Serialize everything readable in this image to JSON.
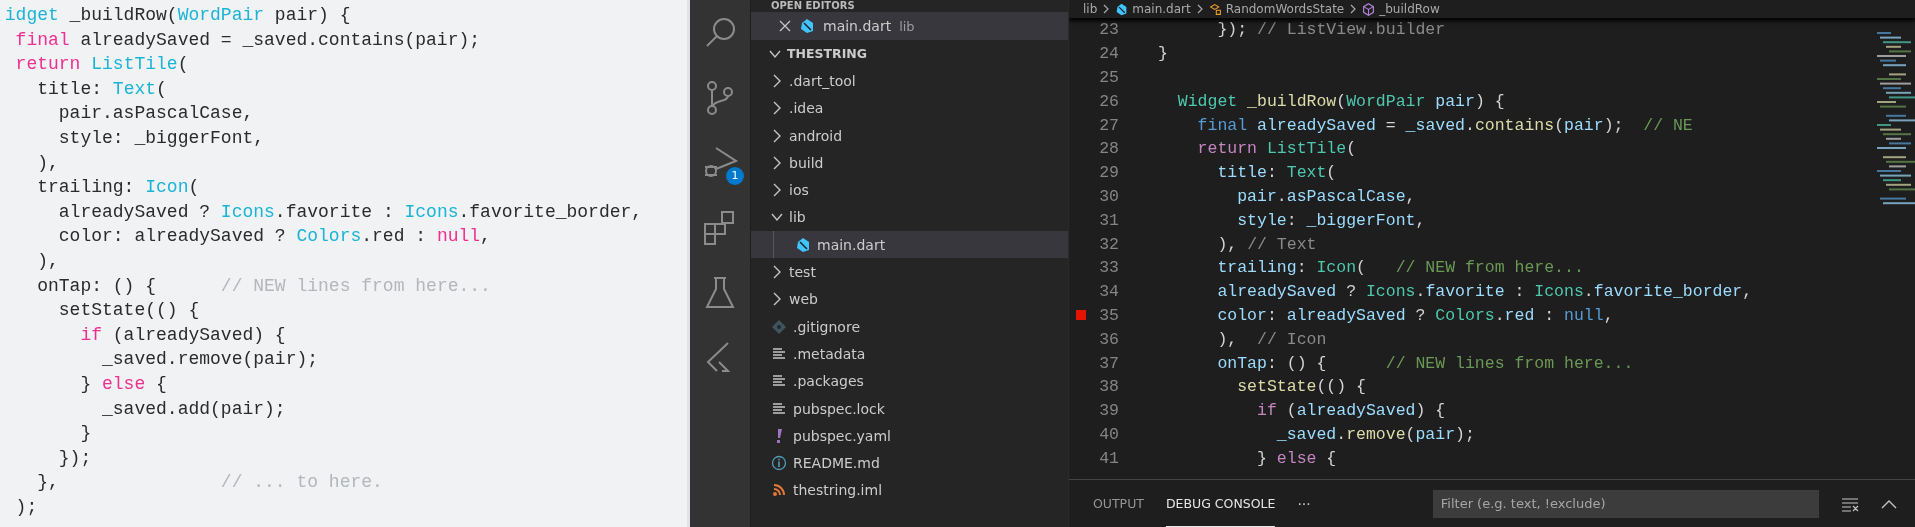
{
  "snippet": {
    "lines": [
      [
        {
          "text": "idget",
          "kind": "type"
        },
        {
          "text": " _buildRow(",
          "kind": "plain"
        },
        {
          "text": "WordPair",
          "kind": "type"
        },
        {
          "text": " pair) {",
          "kind": "plain"
        }
      ],
      [
        {
          "text": " final",
          "kind": "kw"
        },
        {
          "text": " alreadySaved = _saved.contains(pair);",
          "kind": "plain"
        }
      ],
      [
        {
          "text": " return",
          "kind": "kw"
        },
        {
          "text": " ListTile",
          "kind": "type"
        },
        {
          "text": "(",
          "kind": "plain"
        }
      ],
      [
        {
          "text": "   title: ",
          "kind": "plain"
        },
        {
          "text": "Text",
          "kind": "type"
        },
        {
          "text": "(",
          "kind": "plain"
        }
      ],
      [
        {
          "text": "     pair.asPascalCase,",
          "kind": "plain"
        }
      ],
      [
        {
          "text": "     style: _biggerFont,",
          "kind": "plain"
        }
      ],
      [
        {
          "text": "   ),",
          "kind": "plain"
        }
      ],
      [
        {
          "text": "   trailing: ",
          "kind": "plain"
        },
        {
          "text": "Icon",
          "kind": "type"
        },
        {
          "text": "(",
          "kind": "plain"
        }
      ],
      [
        {
          "text": "     alreadySaved ? ",
          "kind": "plain"
        },
        {
          "text": "Icons",
          "kind": "type"
        },
        {
          "text": ".favorite : ",
          "kind": "plain"
        },
        {
          "text": "Icons",
          "kind": "type"
        },
        {
          "text": ".favorite_border,",
          "kind": "plain"
        }
      ],
      [
        {
          "text": "     color: alreadySaved ? ",
          "kind": "plain"
        },
        {
          "text": "Colors",
          "kind": "type"
        },
        {
          "text": ".red : ",
          "kind": "plain"
        },
        {
          "text": "null",
          "kind": "kw"
        },
        {
          "text": ",",
          "kind": "plain"
        }
      ],
      [
        {
          "text": "   ),",
          "kind": "plain"
        }
      ],
      [
        {
          "text": "   onTap: () {      ",
          "kind": "plain"
        },
        {
          "text": "// NEW lines from here...",
          "kind": "comment"
        }
      ],
      [
        {
          "text": "     setState(() {",
          "kind": "plain"
        }
      ],
      [
        {
          "text": "       if",
          "kind": "kw"
        },
        {
          "text": " (alreadySaved) {",
          "kind": "plain"
        }
      ],
      [
        {
          "text": "         _saved.remove(pair);",
          "kind": "plain"
        }
      ],
      [
        {
          "text": "       } ",
          "kind": "plain"
        },
        {
          "text": "else",
          "kind": "kw"
        },
        {
          "text": " {",
          "kind": "plain"
        }
      ],
      [
        {
          "text": "         _saved.add(pair);",
          "kind": "plain"
        }
      ],
      [
        {
          "text": "       }",
          "kind": "plain"
        }
      ],
      [
        {
          "text": "     });",
          "kind": "plain"
        }
      ],
      [
        {
          "text": "   },               ",
          "kind": "plain"
        },
        {
          "text": "// ... to here.",
          "kind": "comment"
        }
      ],
      [
        {
          "text": " );",
          "kind": "plain"
        }
      ]
    ]
  },
  "activity_bar": {
    "debug_badge": "1"
  },
  "explorer": {
    "open_editors_header": "OPEN EDITORS",
    "open_editors": [
      {
        "name": "main.dart",
        "description": "lib",
        "kind": "dart"
      }
    ],
    "folder": {
      "name": "THESTRING",
      "expanded": true
    },
    "tree": [
      {
        "name": ".dart_tool",
        "kind": "folder",
        "expanded": false,
        "selected": false
      },
      {
        "name": ".idea",
        "kind": "folder",
        "expanded": false,
        "selected": false
      },
      {
        "name": "android",
        "kind": "folder",
        "expanded": false,
        "selected": false
      },
      {
        "name": "build",
        "kind": "folder",
        "expanded": false,
        "selected": false
      },
      {
        "name": "ios",
        "kind": "folder",
        "expanded": false,
        "selected": false
      },
      {
        "name": "lib",
        "kind": "folder",
        "expanded": true,
        "selected": false,
        "children": [
          {
            "name": "main.dart",
            "kind": "dart",
            "selected": true
          }
        ]
      },
      {
        "name": "test",
        "kind": "folder",
        "expanded": false,
        "selected": false
      },
      {
        "name": "web",
        "kind": "folder",
        "expanded": false,
        "selected": false
      },
      {
        "name": ".gitignore",
        "kind": "git",
        "selected": false
      },
      {
        "name": ".metadata",
        "kind": "text",
        "selected": false
      },
      {
        "name": ".packages",
        "kind": "text",
        "selected": false
      },
      {
        "name": "pubspec.lock",
        "kind": "text",
        "selected": false
      },
      {
        "name": "pubspec.yaml",
        "kind": "yaml",
        "selected": false
      },
      {
        "name": "README.md",
        "kind": "info",
        "selected": false
      },
      {
        "name": "thestring.iml",
        "kind": "feed",
        "selected": false
      }
    ]
  },
  "editor": {
    "breadcrumbs": [
      {
        "label": "lib",
        "kind": "folder"
      },
      {
        "label": "main.dart",
        "kind": "dart"
      },
      {
        "label": "RandomWordsState",
        "kind": "class"
      },
      {
        "label": "_buildRow",
        "kind": "method"
      }
    ],
    "lines": [
      {
        "n": "23",
        "breakpoint": false,
        "tokens": [
          {
            "text": "      });",
            "kind": "plain"
          },
          {
            "text": " // ListView.builder",
            "kind": "label"
          }
        ]
      },
      {
        "n": "24",
        "breakpoint": false,
        "tokens": [
          {
            "text": "}",
            "kind": "plain"
          }
        ]
      },
      {
        "n": "25",
        "breakpoint": false
      },
      {
        "n": "26",
        "breakpoint": false,
        "tokens": [
          {
            "text": "  Widget",
            "kind": "type"
          },
          {
            "text": " _buildRow",
            "kind": "fn"
          },
          {
            "text": "(",
            "kind": "plain"
          },
          {
            "text": "WordPair",
            "kind": "type"
          },
          {
            "text": " pair",
            "kind": "var"
          },
          {
            "text": ") {",
            "kind": "plain"
          }
        ]
      },
      {
        "n": "27",
        "breakpoint": false,
        "tokens": [
          {
            "text": "    final",
            "kind": "kw"
          },
          {
            "text": " alreadySaved",
            "kind": "var"
          },
          {
            "text": " = ",
            "kind": "plain"
          },
          {
            "text": "_saved",
            "kind": "var"
          },
          {
            "text": ".",
            "kind": "plain"
          },
          {
            "text": "contains",
            "kind": "fn"
          },
          {
            "text": "(",
            "kind": "plain"
          },
          {
            "text": "pair",
            "kind": "var"
          },
          {
            "text": ");  ",
            "kind": "plain"
          },
          {
            "text": "// NE",
            "kind": "comment"
          }
        ]
      },
      {
        "n": "28",
        "breakpoint": false,
        "tokens": [
          {
            "text": "    return",
            "kind": "ctrl"
          },
          {
            "text": " ListTile",
            "kind": "type"
          },
          {
            "text": "(",
            "kind": "plain"
          }
        ]
      },
      {
        "n": "29",
        "breakpoint": false,
        "tokens": [
          {
            "text": "      title",
            "kind": "var"
          },
          {
            "text": ": ",
            "kind": "plain"
          },
          {
            "text": "Text",
            "kind": "type"
          },
          {
            "text": "(",
            "kind": "plain"
          }
        ]
      },
      {
        "n": "30",
        "breakpoint": false,
        "tokens": [
          {
            "text": "        pair",
            "kind": "var"
          },
          {
            "text": ".",
            "kind": "plain"
          },
          {
            "text": "asPascalCase",
            "kind": "var"
          },
          {
            "text": ",",
            "kind": "plain"
          }
        ]
      },
      {
        "n": "31",
        "breakpoint": false,
        "tokens": [
          {
            "text": "        style",
            "kind": "var"
          },
          {
            "text": ": ",
            "kind": "plain"
          },
          {
            "text": "_biggerFont",
            "kind": "var"
          },
          {
            "text": ",",
            "kind": "plain"
          }
        ]
      },
      {
        "n": "32",
        "breakpoint": false,
        "tokens": [
          {
            "text": "      ), ",
            "kind": "plain"
          },
          {
            "text": "// Text",
            "kind": "label"
          }
        ]
      },
      {
        "n": "33",
        "breakpoint": false,
        "tokens": [
          {
            "text": "      trailing",
            "kind": "var"
          },
          {
            "text": ": ",
            "kind": "plain"
          },
          {
            "text": "Icon",
            "kind": "type"
          },
          {
            "text": "(   ",
            "kind": "plain"
          },
          {
            "text": "// NEW from here...",
            "kind": "comment"
          }
        ]
      },
      {
        "n": "34",
        "breakpoint": false,
        "tokens": [
          {
            "text": "      alreadySaved",
            "kind": "var"
          },
          {
            "text": " ? ",
            "kind": "plain"
          },
          {
            "text": "Icons",
            "kind": "type"
          },
          {
            "text": ".",
            "kind": "plain"
          },
          {
            "text": "favorite",
            "kind": "var"
          },
          {
            "text": " : ",
            "kind": "plain"
          },
          {
            "text": "Icons",
            "kind": "type"
          },
          {
            "text": ".",
            "kind": "plain"
          },
          {
            "text": "favorite_border",
            "kind": "var"
          },
          {
            "text": ",",
            "kind": "plain"
          }
        ]
      },
      {
        "n": "35",
        "breakpoint": true,
        "tokens": [
          {
            "text": "      color",
            "kind": "var"
          },
          {
            "text": ": ",
            "kind": "plain"
          },
          {
            "text": "alreadySaved",
            "kind": "var"
          },
          {
            "text": " ? ",
            "kind": "plain"
          },
          {
            "text": "Colors",
            "kind": "type"
          },
          {
            "text": ".",
            "kind": "plain"
          },
          {
            "text": "red",
            "kind": "var"
          },
          {
            "text": " : ",
            "kind": "plain"
          },
          {
            "text": "null",
            "kind": "kw"
          },
          {
            "text": ",",
            "kind": "plain"
          }
        ]
      },
      {
        "n": "36",
        "breakpoint": false,
        "tokens": [
          {
            "text": "      ),  ",
            "kind": "plain"
          },
          {
            "text": "// Icon",
            "kind": "label"
          }
        ]
      },
      {
        "n": "37",
        "breakpoint": false,
        "tokens": [
          {
            "text": "      onTap",
            "kind": "var"
          },
          {
            "text": ": () {      ",
            "kind": "plain"
          },
          {
            "text": "// NEW lines from here...",
            "kind": "comment"
          }
        ]
      },
      {
        "n": "38",
        "breakpoint": false,
        "tokens": [
          {
            "text": "        setState",
            "kind": "fn"
          },
          {
            "text": "(() {",
            "kind": "plain"
          }
        ]
      },
      {
        "n": "39",
        "breakpoint": false,
        "tokens": [
          {
            "text": "          if",
            "kind": "ctrl"
          },
          {
            "text": " (",
            "kind": "plain"
          },
          {
            "text": "alreadySaved",
            "kind": "var"
          },
          {
            "text": ") {",
            "kind": "plain"
          }
        ]
      },
      {
        "n": "40",
        "breakpoint": false,
        "tokens": [
          {
            "text": "            _saved",
            "kind": "var"
          },
          {
            "text": ".",
            "kind": "plain"
          },
          {
            "text": "remove",
            "kind": "fn"
          },
          {
            "text": "(",
            "kind": "plain"
          },
          {
            "text": "pair",
            "kind": "var"
          },
          {
            "text": ");",
            "kind": "plain"
          }
        ]
      },
      {
        "n": "41",
        "breakpoint": false,
        "tokens": [
          {
            "text": "          } ",
            "kind": "plain"
          },
          {
            "text": "else",
            "kind": "ctrl"
          },
          {
            "text": " {",
            "kind": "plain"
          }
        ]
      }
    ]
  },
  "panel": {
    "tabs": [
      {
        "label": "OUTPUT",
        "selected": false
      },
      {
        "label": "DEBUG CONSOLE",
        "selected": true
      }
    ],
    "more": "···",
    "filter": {
      "placeholder": "Filter (e.g. text, !exclude)"
    }
  }
}
